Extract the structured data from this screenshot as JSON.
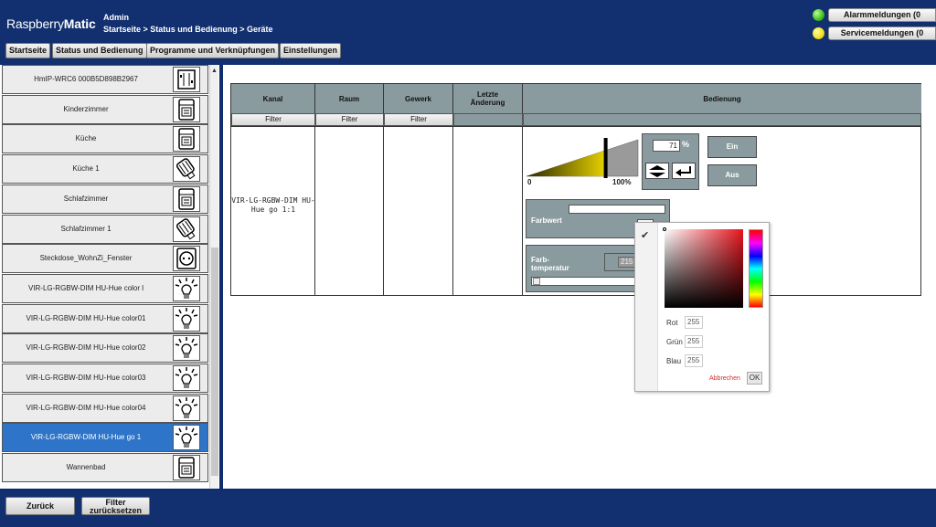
{
  "header": {
    "logo_part1": "Raspberry",
    "logo_part2": "Matic",
    "user": "Admin",
    "breadcrumb": "Startseite > Status und Bedienung > Geräte",
    "nav": [
      {
        "label": "Startseite"
      },
      {
        "label": "Status und Bedienung"
      },
      {
        "label": "Programme und Verknüpfungen"
      },
      {
        "label": "Einstellungen"
      }
    ],
    "alarm_label": "Alarmmeldungen (0",
    "service_label": "Servicemeldungen (0",
    "colors": {
      "alarm_led": "#3fbf1f",
      "service_led": "#f0e020"
    }
  },
  "devices": [
    {
      "name": "HmIP-WRC6 000B5D898B2967",
      "icon": "wall-switch-icon"
    },
    {
      "name": "Kinderzimmer",
      "icon": "thermostat-icon"
    },
    {
      "name": "Küche",
      "icon": "thermostat-icon"
    },
    {
      "name": "Küche 1",
      "icon": "radiator-valve-icon"
    },
    {
      "name": "Schlafzimmer",
      "icon": "thermostat-icon"
    },
    {
      "name": "Schlafzimmer 1",
      "icon": "radiator-valve-icon"
    },
    {
      "name": "Steckdose_WohnZi_Fenster",
      "icon": "socket-icon"
    },
    {
      "name": "VIR-LG-RGBW-DIM HU-Hue color l",
      "icon": "lamp-icon"
    },
    {
      "name": "VIR-LG-RGBW-DIM HU-Hue color01",
      "icon": "lamp-icon"
    },
    {
      "name": "VIR-LG-RGBW-DIM HU-Hue color02",
      "icon": "lamp-icon"
    },
    {
      "name": "VIR-LG-RGBW-DIM HU-Hue color03",
      "icon": "lamp-icon"
    },
    {
      "name": "VIR-LG-RGBW-DIM HU-Hue color04",
      "icon": "lamp-icon"
    },
    {
      "name": "VIR-LG-RGBW-DIM HU-Hue go 1",
      "icon": "lamp-icon",
      "selected": true
    },
    {
      "name": "Wannenbad",
      "icon": "thermostat-icon"
    }
  ],
  "table": {
    "headers": {
      "kanal": "Kanal",
      "raum": "Raum",
      "gewerk": "Gewerk",
      "letzte": "Letzte Änderung",
      "bedienung": "Bedienung"
    },
    "filter_label": "Filter",
    "channel_name": "VIR-LG-RGBW-DIM HU-Hue go 1:1"
  },
  "control": {
    "level_value": "71",
    "level_fraction": 0.71,
    "level_unit": "%",
    "scale_min": "0",
    "scale_max": "100%",
    "on_label": "Ein",
    "off_label": "Aus",
    "farbwert_label": "Farbwert",
    "farbtemp_label_1": "Farb-",
    "farbtemp_label_2": "temperatur",
    "farbtemp_value": "215"
  },
  "picker": {
    "rot_label": "Rot",
    "rot_value": "255",
    "gruen_label": "Grün",
    "gruen_value": "255",
    "blau_label": "Blau",
    "blau_value": "255",
    "cancel_label": "Abbrechen",
    "ok_label": "OK"
  },
  "footer": {
    "back_label": "Zurück",
    "reset_line1": "Filter",
    "reset_line2": "zurücksetzen"
  }
}
